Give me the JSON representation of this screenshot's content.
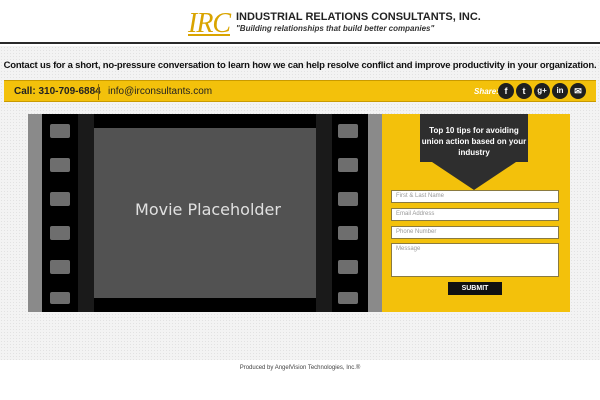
{
  "header": {
    "logo_text": "IRC",
    "company_name": "INDUSTRIAL RELATIONS CONSULTANTS, INC.",
    "tagline": "\"Building relationships that build better companies\""
  },
  "intro": {
    "text": "Contact us for a short, no-pressure conversation to learn how we can help resolve conflict and improve productivity in your organization."
  },
  "contact_bar": {
    "call_label": "Call: 310-709-6884",
    "email_label": "info@irconsultants.com",
    "share_label": "Share:",
    "social_icons": [
      "facebook-icon",
      "twitter-icon",
      "google-plus-icon",
      "linkedin-icon",
      "email-icon"
    ],
    "social_glyphs": [
      "f",
      "t",
      "g+",
      "in",
      "✉"
    ]
  },
  "video": {
    "placeholder_text": "Movie Placeholder"
  },
  "lead_form": {
    "title": "Top 10 tips for avoiding union action based on your industry",
    "name_placeholder": "First & Last Name",
    "email_placeholder": "Email Address",
    "phone_placeholder": "Phone Number",
    "message_placeholder": "Message",
    "submit_label": "SUBMIT"
  },
  "footer": {
    "credit": "Produced by AngelVision Technologies, Inc.®"
  },
  "colors": {
    "accent": "#f3c10b",
    "logo": "#d9a400",
    "dark": "#1f1f1f"
  }
}
